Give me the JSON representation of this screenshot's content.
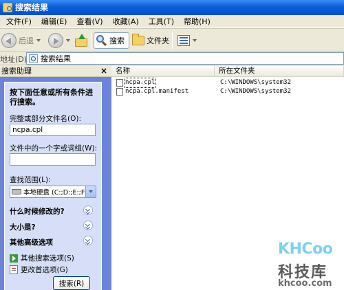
{
  "window": {
    "title": "搜索结果"
  },
  "menubar": [
    {
      "label": "文件(F)"
    },
    {
      "label": "编辑(E)"
    },
    {
      "label": "查看(V)"
    },
    {
      "label": "收藏(A)"
    },
    {
      "label": "工具(T)"
    },
    {
      "label": "帮助(H)"
    }
  ],
  "toolbar": {
    "back_label": "后退",
    "search_label": "搜索",
    "folders_label": "文件夹"
  },
  "address": {
    "label": "地址(D)",
    "value": "搜索结果"
  },
  "search_pane": {
    "title": "搜索助理",
    "close_glyph": "×",
    "heading": "按下面任意或所有条件进行搜索。",
    "filename_label": "完整或部分文件名(O):",
    "filename_value": "ncpa.cpl",
    "word_label": "文件中的一个字或词组(W):",
    "word_value": "",
    "lookin_label": "查找范围(L):",
    "lookin_value": "本地硬盘 (C:;D:;E:;F:",
    "sections": [
      {
        "label": "什么时候修改的?"
      },
      {
        "label": "大小是?"
      },
      {
        "label": "其他高级选项"
      }
    ],
    "links": [
      {
        "label": "其他搜索选项(S)"
      },
      {
        "label": "更改首选项(G)"
      }
    ],
    "search_button": "搜索(R)"
  },
  "results": {
    "columns": [
      "名称",
      "所在文件夹"
    ],
    "rows": [
      {
        "name": "ncpa.cpl",
        "folder": "C:\\WINDOWS\\system32"
      },
      {
        "name": "ncpa.cpl.manifest",
        "folder": "C:\\WINDOWS\\system32"
      }
    ]
  },
  "watermark": {
    "logo": "KHCoo",
    "name": "科技库",
    "url": "khcoo.com"
  },
  "colors": {
    "titlebar": "#0a5fd8",
    "pane_bg": "#6b84d9",
    "pane_inner": "#d6dff7",
    "chrome": "#ece9d8"
  }
}
